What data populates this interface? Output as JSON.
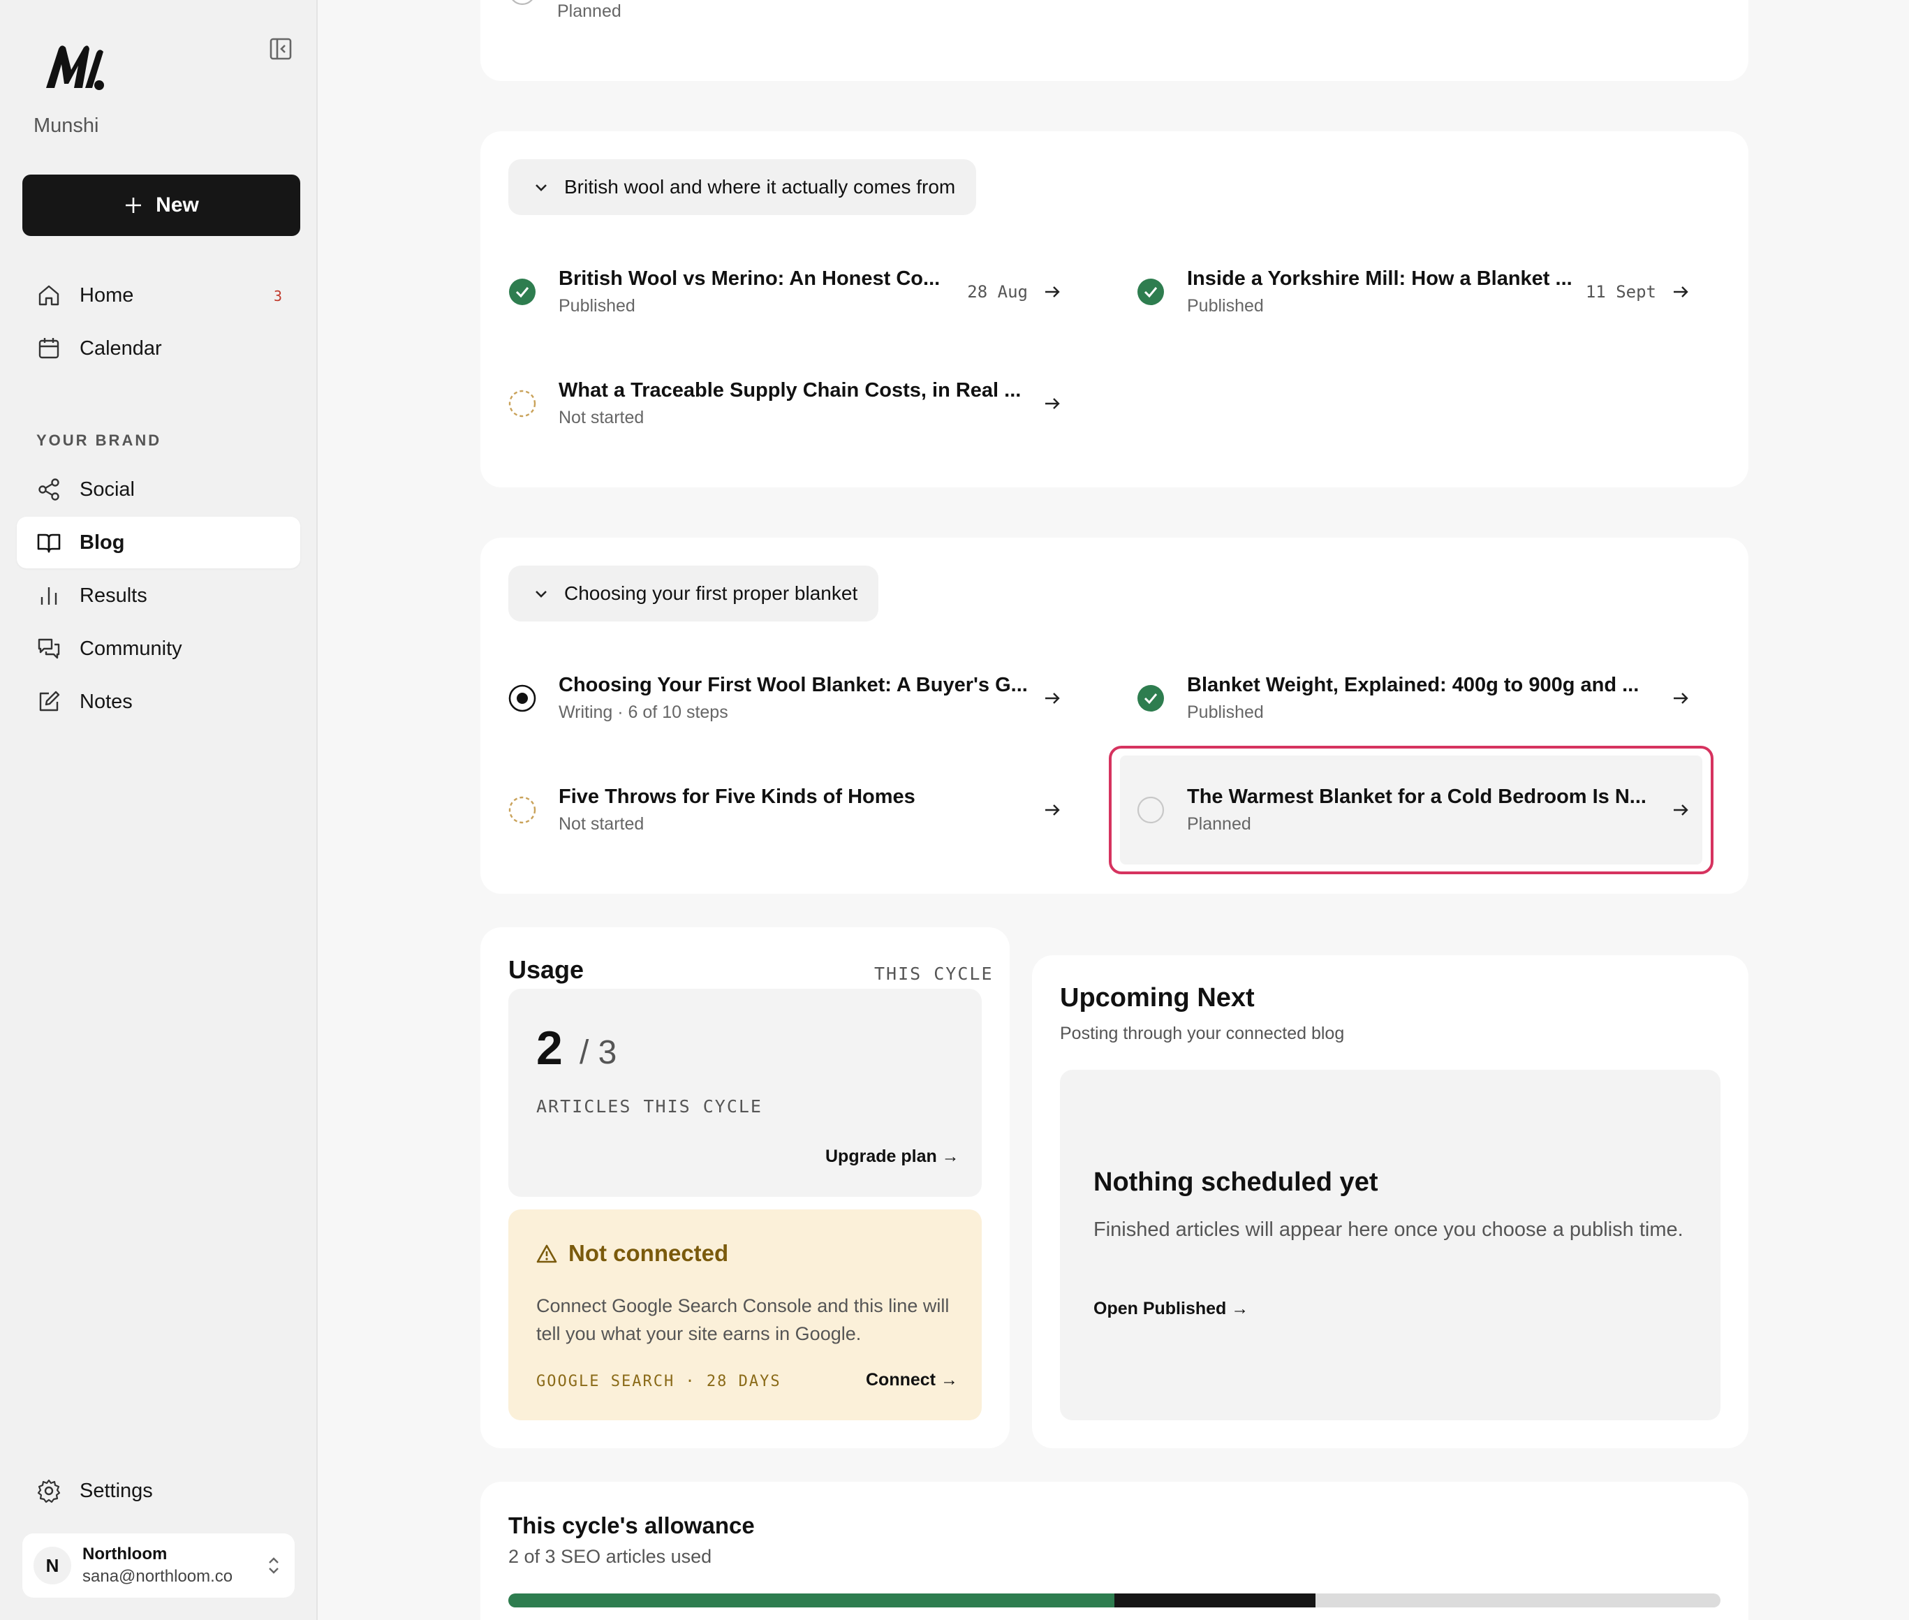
{
  "sidebar": {
    "brand": "Munshi",
    "new_label": "New",
    "nav": [
      {
        "label": "Home",
        "badge": "3"
      },
      {
        "label": "Calendar"
      }
    ],
    "section_label": "YOUR BRAND",
    "brand_nav": [
      {
        "label": "Social"
      },
      {
        "label": "Blog",
        "active": true
      },
      {
        "label": "Results"
      },
      {
        "label": "Community"
      },
      {
        "label": "Notes"
      }
    ],
    "settings_label": "Settings",
    "account": {
      "initial": "N",
      "name": "Northloom",
      "email": "sana@northloom.co"
    }
  },
  "top_card": {
    "status_text": "Planned"
  },
  "groups": [
    {
      "title": "British wool and where it actually comes from",
      "articles": [
        {
          "title": "British Wool vs Merino: An Honest Co...",
          "status": "Published",
          "date": "28 Aug"
        },
        {
          "title": "Inside a Yorkshire Mill: How a Blanket ...",
          "status": "Published",
          "date": "11 Sept"
        },
        {
          "title": "What a Traceable Supply Chain Costs, in Real ...",
          "status": "Not started",
          "date": ""
        }
      ]
    },
    {
      "title": "Choosing your first proper blanket",
      "articles": [
        {
          "title": "Choosing Your First Wool Blanket: A Buyer's G...",
          "status": "Writing · 6 of 10 steps",
          "date": ""
        },
        {
          "title": "Blanket Weight, Explained: 400g to 900g and ...",
          "status": "Published",
          "date": ""
        },
        {
          "title": "Five Throws for Five Kinds of Homes",
          "status": "Not started",
          "date": ""
        },
        {
          "title": "The Warmest Blanket for a Cold Bedroom Is N...",
          "status": "Planned",
          "date": ""
        }
      ]
    }
  ],
  "usage": {
    "title": "Usage",
    "cycle_label": "THIS CYCLE",
    "used": "2",
    "total": "/ 3",
    "unit_label": "ARTICLES THIS CYCLE",
    "upgrade_label": "Upgrade plan →",
    "warning": {
      "title": "Not connected",
      "text": "Connect Google Search Console and this line will tell you what your site earns in Google.",
      "footer": "GOOGLE SEARCH · 28 DAYS",
      "connect_label": "Connect →"
    }
  },
  "upcoming": {
    "title": "Upcoming Next",
    "subtitle": "Posting through your connected blog",
    "empty_title": "Nothing scheduled yet",
    "empty_text": "Finished articles will appear here once you choose a publish time.",
    "link_label": "Open Published →"
  },
  "allowance": {
    "title": "This cycle's allowance",
    "subtitle": "2 of 3 SEO articles used",
    "used_fraction": 0.5,
    "pending_fraction": 0.166
  },
  "colors": {
    "published": "#2e7d4f",
    "not_started": "#c9a25a",
    "highlight": "#d6335f",
    "warning_bg": "#fbf0d9"
  }
}
